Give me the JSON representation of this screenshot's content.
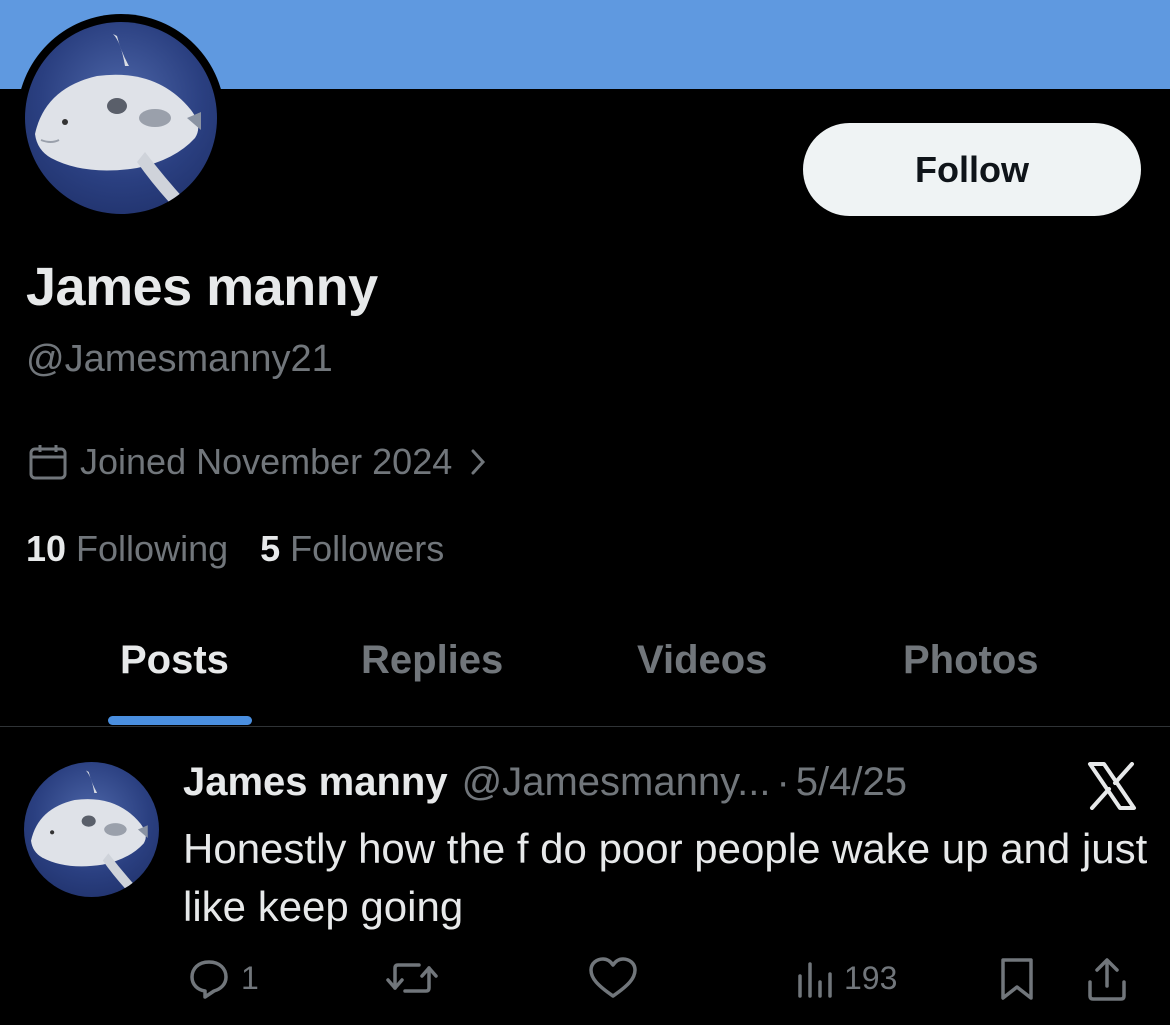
{
  "profile": {
    "name": "James manny",
    "handle": "@Jamesmanny21",
    "joined": "Joined November 2024",
    "following_count": "10",
    "following_label": "Following",
    "followers_count": "5",
    "followers_label": "Followers",
    "follow_label": "Follow",
    "banner_color": "#5f99e0",
    "avatar_icon": "sunfish-avatar"
  },
  "tabs": [
    {
      "label": "Posts",
      "active": true
    },
    {
      "label": "Replies",
      "active": false
    },
    {
      "label": "Videos",
      "active": false
    },
    {
      "label": "Photos",
      "active": false
    }
  ],
  "post": {
    "author_name": "James manny",
    "author_handle": "@Jamesmanny...",
    "separator": "·",
    "date": "5/4/25",
    "text": "Honestly how the f do poor people wake up and just like keep going",
    "reply_count": "1",
    "view_count": "193",
    "source_icon": "x-logo-icon"
  },
  "colors": {
    "accent": "#4a8fe0",
    "secondary_text": "#71767b",
    "primary_text": "#e7e9ea",
    "background": "#000000"
  }
}
